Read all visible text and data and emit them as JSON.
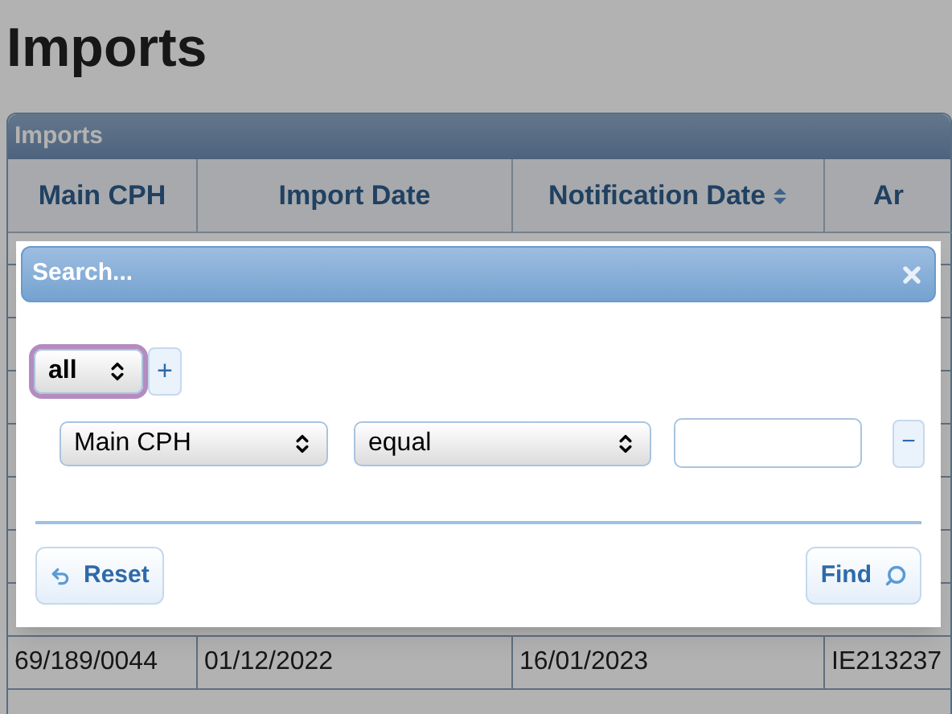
{
  "page_title": "Imports",
  "panel": {
    "title": "Imports",
    "columns": [
      {
        "label": "Main CPH",
        "sorted": false
      },
      {
        "label": "Import Date",
        "sorted": false
      },
      {
        "label": "Notification Date",
        "sorted": true
      },
      {
        "label": "Ar",
        "sorted": false
      }
    ],
    "rows_bottom": [
      [
        "69/189/0044",
        "01/12/2022",
        "16/01/2023",
        "IE213237"
      ]
    ]
  },
  "search_dialog": {
    "title": "Search...",
    "group": {
      "operator": "all",
      "focused": true,
      "add_label": "+"
    },
    "rules": [
      {
        "field": "Main CPH",
        "operator": "equal",
        "remove_label": "−"
      }
    ],
    "buttons": [
      {
        "kind": "reset",
        "label": "Reset"
      },
      {
        "kind": "find",
        "label": "Find"
      }
    ]
  }
}
